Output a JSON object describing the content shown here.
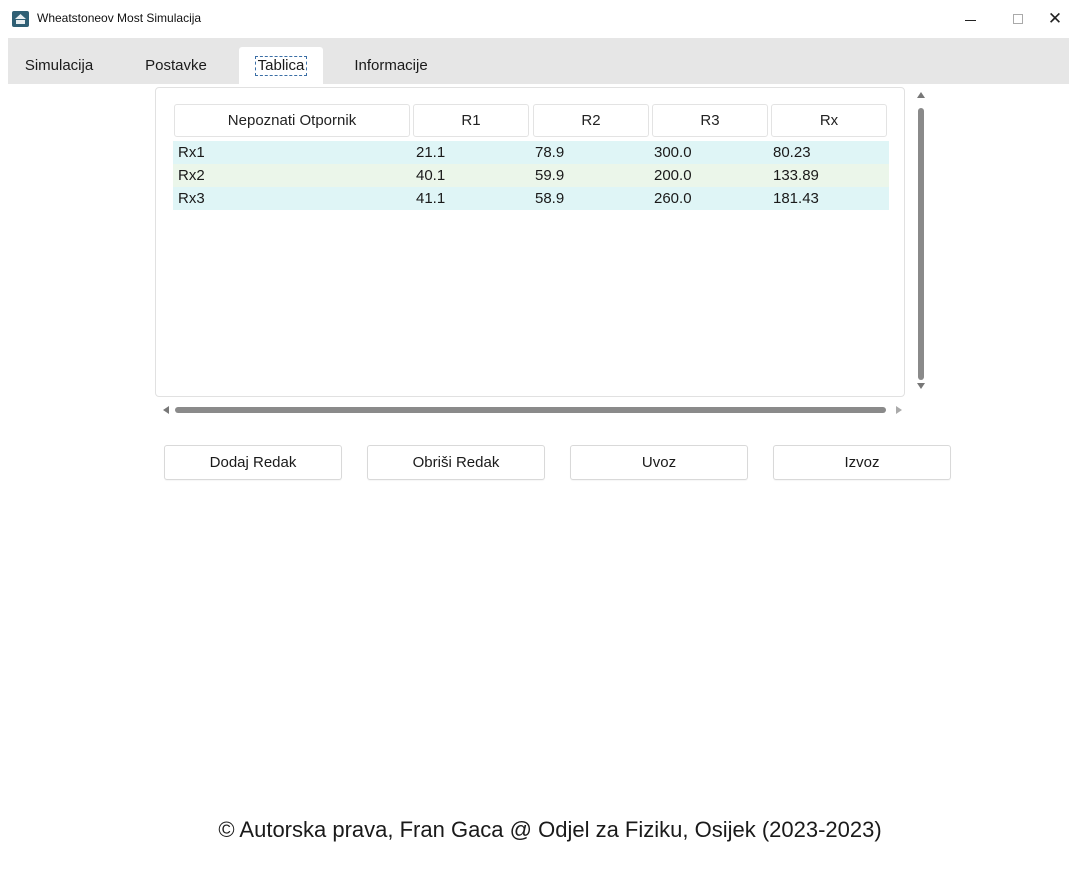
{
  "window": {
    "title": "Wheatstoneov Most Simulacija",
    "controls": {
      "minimize": "–",
      "maximize": "□",
      "close": "✕"
    }
  },
  "tabs": [
    {
      "label": "Simulacija",
      "active": false
    },
    {
      "label": "Postavke",
      "active": false
    },
    {
      "label": "Tablica",
      "active": true
    },
    {
      "label": "Informacije",
      "active": false
    }
  ],
  "table": {
    "columns": [
      "Nepoznati Otpornik",
      "R1",
      "R2",
      "R3",
      "Rx"
    ],
    "rows": [
      [
        "Rx1",
        "21.1",
        "78.9",
        "300.0",
        "80.23"
      ],
      [
        "Rx2",
        "40.1",
        "59.9",
        "200.0",
        "133.89"
      ],
      [
        "Rx3",
        "41.1",
        "58.9",
        "260.0",
        "181.43"
      ]
    ]
  },
  "buttons": {
    "add_row": "Dodaj Redak",
    "delete_row": "Obriši Redak",
    "import": "Uvoz",
    "export": "Izvoz"
  },
  "footer": "© Autorska prava, Fran Gaca @ Odjel za Fiziku, Osijek (2023-2023)",
  "colors": {
    "tabbar_bg": "#e6e6e6",
    "row_odd_bg": "#dff5f6",
    "row_even_bg": "#ebf6ea",
    "scrollbar_thumb": "#8a8a8a",
    "app_icon": "#2f5f74"
  }
}
